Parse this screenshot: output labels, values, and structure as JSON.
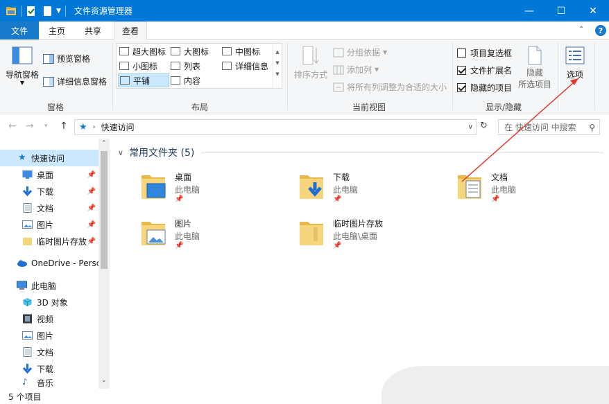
{
  "window": {
    "title": "文件资源管理器",
    "minimize": "—",
    "maximize": "☐",
    "close": "✕"
  },
  "tabs": [
    "文件",
    "主页",
    "共享",
    "查看"
  ],
  "help_label": "?",
  "ribbon": {
    "pane_group": {
      "label": "窗格",
      "nav_pane": "导航窗格",
      "preview_pane": "预览窗格",
      "details_pane": "详细信息窗格"
    },
    "layout_group": {
      "label": "布局",
      "items": [
        "超大图标",
        "大图标",
        "中图标",
        "小图标",
        "列表",
        "详细信息",
        "平铺",
        "内容"
      ],
      "selected": "平铺"
    },
    "view_group": {
      "label": "当前视图",
      "sort_by": "排序方式",
      "group_by": "分组依据",
      "add_columns": "添加列",
      "fit_columns": "将所有列调整为合适的大小"
    },
    "show_group": {
      "label": "显示/隐藏",
      "item_checkboxes": "项目复选框",
      "item_checkboxes_checked": false,
      "file_extensions": "文件扩展名",
      "file_extensions_checked": true,
      "hidden_items": "隐藏的项目",
      "hidden_items_checked": true,
      "hide_selected_line1": "隐藏",
      "hide_selected_line2": "所选项目"
    },
    "options_label": "选项"
  },
  "address": {
    "path": "快速访问",
    "search_placeholder": "在 快速访问 中搜索"
  },
  "nav_pane": {
    "quick_access": "快速访问",
    "quick_items": [
      "桌面",
      "下载",
      "文档",
      "图片",
      "临时图片存放"
    ],
    "onedrive": "OneDrive - Persc",
    "this_pc": "此电脑",
    "pc_items": [
      "3D 对象",
      "视频",
      "图片",
      "文档",
      "下载",
      "音乐"
    ]
  },
  "content": {
    "group_title": "常用文件夹 (5)",
    "folders": [
      {
        "name": "桌面",
        "location": "此电脑"
      },
      {
        "name": "下载",
        "location": "此电脑"
      },
      {
        "name": "文档",
        "location": "此电脑"
      },
      {
        "name": "图片",
        "location": "此电脑"
      },
      {
        "name": "临时图片存放",
        "location": "此电脑\\桌面"
      }
    ]
  },
  "status": {
    "item_count": "5 个项目"
  },
  "colors": {
    "titlebar": "#0078d7",
    "file_tab": "#1979ca",
    "selection": "#cce8ff",
    "annotation_arrow": "#e03c31"
  }
}
